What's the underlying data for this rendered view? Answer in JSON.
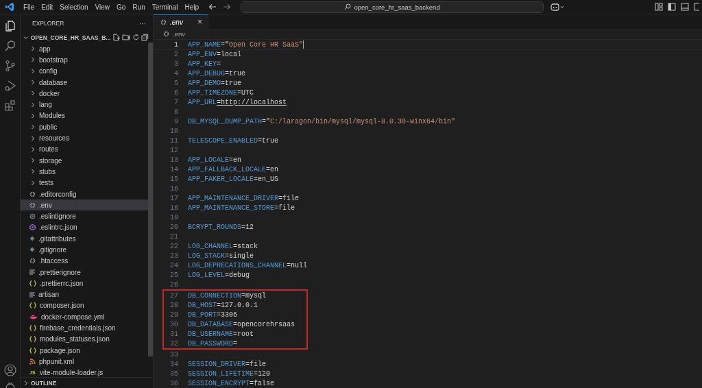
{
  "menu": [
    "File",
    "Edit",
    "Selection",
    "View",
    "Go",
    "Run",
    "Terminal",
    "Help"
  ],
  "command_center": {
    "value": "open_core_hr_saas_backend"
  },
  "explorer": {
    "title": "EXPLORER",
    "more": "···",
    "project": "OPEN_CORE_HR_SAAS_B...",
    "expanded": true,
    "items": [
      {
        "kind": "folder",
        "name": "app",
        "selected": false
      },
      {
        "kind": "folder",
        "name": "bootstrap",
        "selected": false
      },
      {
        "kind": "folder",
        "name": "config",
        "selected": false
      },
      {
        "kind": "folder",
        "name": "database",
        "selected": false
      },
      {
        "kind": "folder",
        "name": "docker",
        "selected": false
      },
      {
        "kind": "folder",
        "name": "lang",
        "selected": false
      },
      {
        "kind": "folder",
        "name": "Modules",
        "selected": false
      },
      {
        "kind": "folder",
        "name": "public",
        "selected": false
      },
      {
        "kind": "folder",
        "name": "resources",
        "selected": false
      },
      {
        "kind": "folder",
        "name": "routes",
        "selected": false
      },
      {
        "kind": "folder",
        "name": "storage",
        "selected": false
      },
      {
        "kind": "folder",
        "name": "stubs",
        "selected": false
      },
      {
        "kind": "folder",
        "name": "tests",
        "selected": false
      },
      {
        "kind": "settings",
        "name": ".editorconfig",
        "selected": false
      },
      {
        "kind": "settings",
        "name": ".env",
        "selected": true
      },
      {
        "kind": "ignore",
        "name": ".eslintignore",
        "selected": false
      },
      {
        "kind": "eslint",
        "name": ".eslintrc.json",
        "selected": false
      },
      {
        "kind": "git",
        "name": ".gitattributes",
        "selected": false
      },
      {
        "kind": "git",
        "name": ".gitignore",
        "selected": false
      },
      {
        "kind": "settings",
        "name": ".htaccess",
        "selected": false
      },
      {
        "kind": "text",
        "name": ".prettierignore",
        "selected": false
      },
      {
        "kind": "json",
        "name": ".prettierrc.json",
        "selected": false
      },
      {
        "kind": "text",
        "name": "artisan",
        "selected": false
      },
      {
        "kind": "json",
        "name": "composer.json",
        "selected": false
      },
      {
        "kind": "docker",
        "name": "docker-compose.yml",
        "selected": false
      },
      {
        "kind": "json",
        "name": "firebase_credentials.json",
        "selected": false
      },
      {
        "kind": "json",
        "name": "modules_statuses.json",
        "selected": false
      },
      {
        "kind": "json",
        "name": "package.json",
        "selected": false
      },
      {
        "kind": "xml",
        "name": "phpunit.xml",
        "selected": false
      },
      {
        "kind": "script",
        "badge": "JS",
        "name": "vite-module-loader.js",
        "selected": false
      }
    ],
    "outline": {
      "title": "OUTLINE",
      "expanded": false
    }
  },
  "tabs": [
    {
      "label": ".env",
      "selected": true,
      "close": "×"
    }
  ],
  "breadcrumb": ".env",
  "lines": [
    {
      "number": "1",
      "text": "APP_NAME=\"Open Core HR SaaS\"",
      "kind": "string",
      "active": true,
      "highlighted": false
    },
    {
      "number": "2",
      "text": "APP_ENV=local",
      "kind": "plain",
      "active": false,
      "highlighted": false
    },
    {
      "number": "3",
      "text": "APP_KEY=",
      "kind": "plain",
      "active": false,
      "highlighted": false
    },
    {
      "number": "4",
      "text": "APP_DEBUG=true",
      "kind": "plain",
      "active": false,
      "highlighted": false
    },
    {
      "number": "5",
      "text": "APP_DEMO=true",
      "kind": "plain",
      "active": false,
      "highlighted": false
    },
    {
      "number": "6",
      "text": "APP_TIMEZONE=UTC",
      "kind": "plain",
      "active": false,
      "highlighted": false
    },
    {
      "number": "7",
      "text": "APP_URL=http://localhost",
      "kind": "link",
      "active": false,
      "highlighted": false
    },
    {
      "number": "8",
      "kind": "blank",
      "active": false,
      "highlighted": false
    },
    {
      "number": "9",
      "text": "DB_MYSQL_DUMP_PATH=\"C:/laragon/bin/mysql/mysql-8.0.30-winx64/bin\"",
      "kind": "string",
      "active": false,
      "highlighted": false
    },
    {
      "number": "10",
      "kind": "blank",
      "active": false,
      "highlighted": false
    },
    {
      "number": "11",
      "text": "TELESCOPE_ENABLED=true",
      "kind": "plain",
      "active": false,
      "highlighted": false
    },
    {
      "number": "12",
      "kind": "blank",
      "active": false,
      "highlighted": false
    },
    {
      "number": "13",
      "text": "APP_LOCALE=en",
      "kind": "plain",
      "active": false,
      "highlighted": false
    },
    {
      "number": "14",
      "text": "APP_FALLBACK_LOCALE=en",
      "kind": "plain",
      "active": false,
      "highlighted": false
    },
    {
      "number": "15",
      "text": "APP_FAKER_LOCALE=en_US",
      "kind": "plain",
      "active": false,
      "highlighted": false
    },
    {
      "number": "16",
      "kind": "blank",
      "active": false,
      "highlighted": false
    },
    {
      "number": "17",
      "text": "APP_MAINTENANCE_DRIVER=file",
      "kind": "plain",
      "active": false,
      "highlighted": false
    },
    {
      "number": "18",
      "text": "APP_MAINTENANCE_STORE=file",
      "kind": "plain",
      "active": false,
      "highlighted": false
    },
    {
      "number": "19",
      "kind": "blank",
      "active": false,
      "highlighted": false
    },
    {
      "number": "20",
      "text": "BCRYPT_ROUNDS=12",
      "kind": "plain",
      "active": false,
      "highlighted": false
    },
    {
      "number": "21",
      "kind": "blank",
      "active": false,
      "highlighted": false
    },
    {
      "number": "22",
      "text": "LOG_CHANNEL=stack",
      "kind": "plain",
      "active": false,
      "highlighted": false
    },
    {
      "number": "23",
      "text": "LOG_STACK=single",
      "kind": "plain",
      "active": false,
      "highlighted": false
    },
    {
      "number": "24",
      "text": "LOG_DEPRECATIONS_CHANNEL=null",
      "kind": "plain",
      "active": false,
      "highlighted": false
    },
    {
      "number": "25",
      "text": "LOG_LEVEL=debug",
      "kind": "plain",
      "active": false,
      "highlighted": false
    },
    {
      "number": "26",
      "kind": "blank",
      "active": false,
      "highlighted": false
    },
    {
      "number": "27",
      "text": "DB_CONNECTION=mysql",
      "kind": "plain",
      "active": false,
      "highlighted": true
    },
    {
      "number": "28",
      "text": "DB_HOST=127.0.0.1",
      "kind": "plain",
      "active": false,
      "highlighted": true
    },
    {
      "number": "29",
      "text": "DB_PORT=3306",
      "kind": "plain",
      "active": false,
      "highlighted": true
    },
    {
      "number": "30",
      "text": "DB_DATABASE=opencorehrsaas",
      "kind": "plain",
      "active": false,
      "highlighted": true
    },
    {
      "number": "31",
      "text": "DB_USERNAME=root",
      "kind": "plain",
      "active": false,
      "highlighted": true
    },
    {
      "number": "32",
      "text": "DB_PASSWORD=",
      "kind": "plain",
      "active": false,
      "highlighted": true
    },
    {
      "number": "33",
      "kind": "blank",
      "active": false,
      "highlighted": false
    },
    {
      "number": "34",
      "text": "SESSION_DRIVER=file",
      "kind": "plain",
      "active": false,
      "highlighted": false
    },
    {
      "number": "35",
      "text": "SESSION_LIFETIME=120",
      "kind": "plain",
      "active": false,
      "highlighted": false
    },
    {
      "number": "36",
      "text": "SESSION_ENCRYPT=false",
      "kind": "plain",
      "active": false,
      "highlighted": false
    }
  ]
}
